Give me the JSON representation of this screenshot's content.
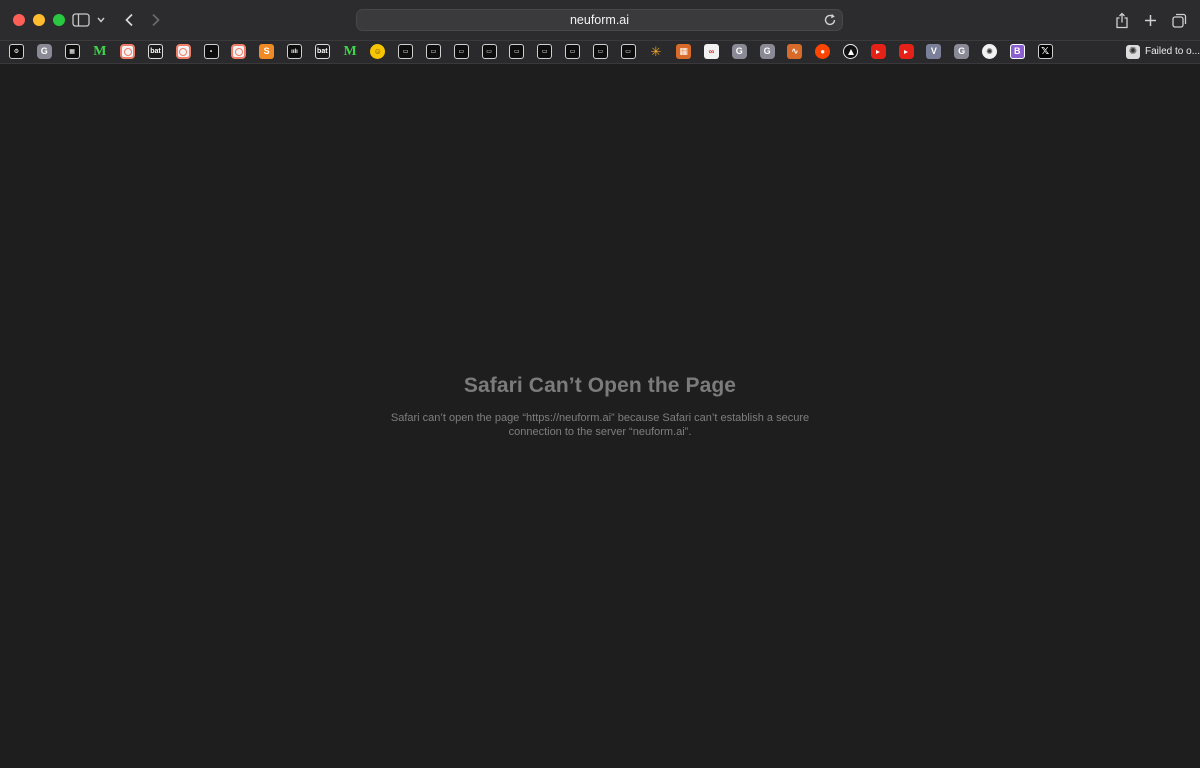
{
  "browser": {
    "app": "Safari",
    "address": "neuform.ai",
    "tab_title": "Failed to o..."
  },
  "favorites": [
    {
      "icon": "gear-icon",
      "letter": "⚙",
      "style": "dark"
    },
    {
      "icon": "g-icon",
      "letter": "G",
      "style": "g"
    },
    {
      "icon": "photo-icon",
      "letter": "▦",
      "style": "dark"
    },
    {
      "icon": "m-icon",
      "letter": "M",
      "style": "mint"
    },
    {
      "icon": "target-icon",
      "letter": "",
      "style": "coral"
    },
    {
      "icon": "batman-icon",
      "letter": "bat",
      "style": "bat"
    },
    {
      "icon": "target-icon",
      "letter": "",
      "style": "coral"
    },
    {
      "icon": "dot-icon",
      "letter": "•",
      "style": "dark"
    },
    {
      "icon": "target-icon",
      "letter": "",
      "style": "coral"
    },
    {
      "icon": "s-icon",
      "letter": "S",
      "style": "orange"
    },
    {
      "icon": "bars-icon",
      "letter": "ıılı",
      "style": "dark"
    },
    {
      "icon": "batman-icon",
      "letter": "bat",
      "style": "bat"
    },
    {
      "icon": "m-icon",
      "letter": "M",
      "style": "mint"
    },
    {
      "icon": "smile-icon",
      "letter": "☺",
      "style": "smile"
    },
    {
      "icon": "site-icon",
      "letter": "▭",
      "style": "dark"
    },
    {
      "icon": "site-icon",
      "letter": "▭",
      "style": "dark"
    },
    {
      "icon": "site-icon",
      "letter": "▭",
      "style": "dark"
    },
    {
      "icon": "site-icon",
      "letter": "▭",
      "style": "dark"
    },
    {
      "icon": "site-icon",
      "letter": "▭",
      "style": "dark"
    },
    {
      "icon": "site-icon",
      "letter": "▭",
      "style": "dark"
    },
    {
      "icon": "site-icon",
      "letter": "▭",
      "style": "dark"
    },
    {
      "icon": "site-icon",
      "letter": "▭",
      "style": "dark"
    },
    {
      "icon": "site-icon",
      "letter": "▭",
      "style": "dark"
    },
    {
      "icon": "walmart-icon",
      "letter": "✳",
      "style": "star"
    },
    {
      "icon": "grid-icon",
      "letter": "▦",
      "style": "ortho"
    },
    {
      "icon": "infinity-icon",
      "letter": "∞",
      "style": "net"
    },
    {
      "icon": "g-icon",
      "letter": "G",
      "style": "g"
    },
    {
      "icon": "g-icon",
      "letter": "G",
      "style": "g"
    },
    {
      "icon": "wave-icon",
      "letter": "∿",
      "style": "ortho"
    },
    {
      "icon": "reddit-icon",
      "letter": "●",
      "style": "reddit"
    },
    {
      "icon": "triangle-icon",
      "letter": "",
      "style": "tri"
    },
    {
      "icon": "youtube-icon",
      "letter": "",
      "style": "yt"
    },
    {
      "icon": "youtube-icon",
      "letter": "",
      "style": "yt"
    },
    {
      "icon": "v-icon",
      "letter": "V",
      "style": "vio"
    },
    {
      "icon": "g-icon",
      "letter": "G",
      "style": "g"
    },
    {
      "icon": "openai-icon",
      "letter": "✺",
      "style": "chat"
    },
    {
      "icon": "b-icon",
      "letter": "B",
      "style": "b"
    },
    {
      "icon": "x-icon",
      "letter": "𝕏",
      "style": "x"
    }
  ],
  "error": {
    "title": "Safari Can’t Open the Page",
    "message": "Safari can’t open the page “https://neuform.ai” because Safari can’t establish a secure connection to the server “neuform.ai”."
  }
}
